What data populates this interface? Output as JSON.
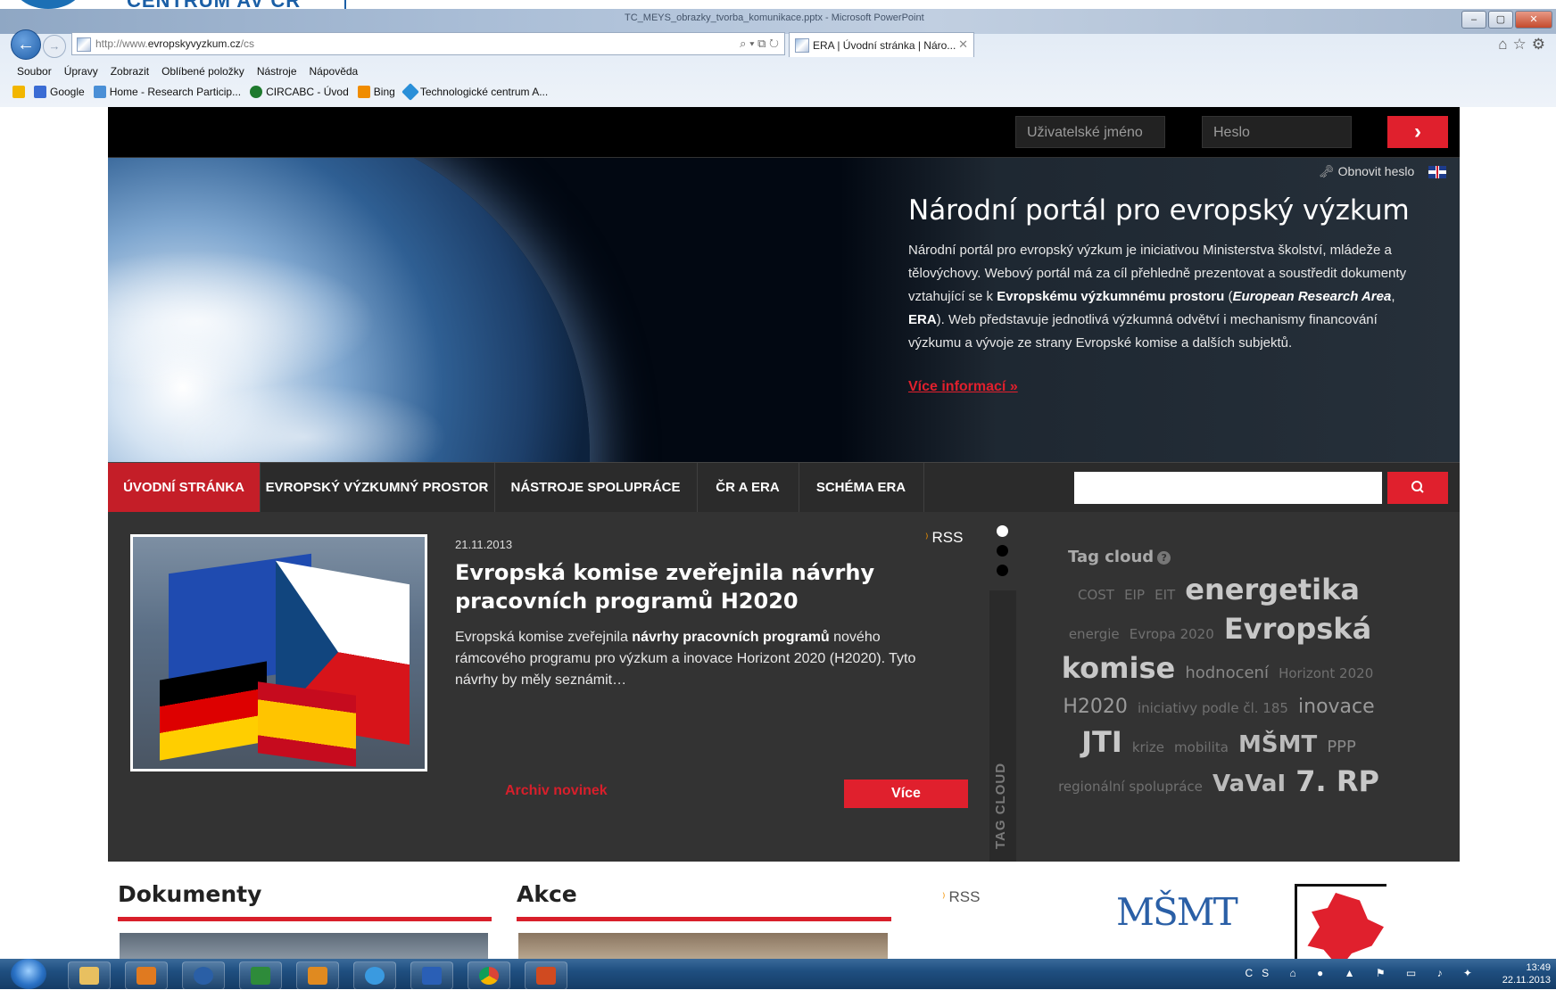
{
  "slide_header": {
    "title": "CENTRUM AV ČR"
  },
  "browser": {
    "window_title": "TC_MEYS_obrazky_tvorba_komunikace.pptx - Microsoft PowerPoint",
    "url_prefix": "http://www.",
    "url_domain": "evropskyvyzkum.cz",
    "url_suffix": "/cs",
    "tab_title": "ERA | Úvodní stránka | Náro...",
    "menu": [
      "Soubor",
      "Úpravy",
      "Zobrazit",
      "Oblíbené položky",
      "Nástroje",
      "Nápověda"
    ],
    "favorites": [
      {
        "label": "",
        "color": "#f2b600"
      },
      {
        "label": "Google",
        "color": "#3a6cd4"
      },
      {
        "label": "Home - Research Particip...",
        "color": "#4a8fd6"
      },
      {
        "label": "CIRCABC - Úvod",
        "color": "#1e7a2e"
      },
      {
        "label": "Bing",
        "color": "#f08c00"
      },
      {
        "label": "Technologické centrum A...",
        "color": "#2a8fd8"
      }
    ]
  },
  "login": {
    "user_placeholder": "Uživatelské jméno",
    "pass_placeholder": "Heslo",
    "submit_icon": "chevron-right-icon",
    "reset_label": "Obnovit heslo",
    "language_icon": "uk-flag-icon"
  },
  "hero": {
    "title": "Národní portál pro evropský výzkum",
    "text_1": "Národní portál pro evropský výzkum je iniciativou Ministerstva školství, mládeže a tělovýchovy. Webový portál má za cíl přehledně prezentovat a soustředit dokumenty vztahující se k ",
    "text_bold_1": "Evropskému výzkumnému prostoru",
    "text_2": " (",
    "text_bold_italic": "European Research Area",
    "text_3": ", ",
    "text_bold_2": "ERA",
    "text_4": "). Web představuje jednotlivá výzkumná odvětví i mechanismy financování výzkumu a vývoje ze strany Evropské komise a dalších subjektů.",
    "more_link": "Více informací »"
  },
  "nav": {
    "items": [
      "ÚVODNÍ STRÁNKA",
      "EVROPSKÝ VÝZKUMNÝ PROSTOR",
      "NÁSTROJE SPOLUPRÁCE",
      "ČR A ERA",
      "SCHÉMA ERA"
    ],
    "search_placeholder": "",
    "search_icon": "search-icon"
  },
  "news": {
    "date": "21.11.2013",
    "rss": "RSS",
    "title": "Evropská komise zveřejnila návrhy pracovních programů H2020",
    "text_1": "Evropská komise zveřejnila ",
    "text_bold": "návrhy pracovních programů",
    "text_2": " nového rámcového programu pro výzkum a inovace Horizont 2020 (H2020). Tyto návrhy by měly seznámit…",
    "archive_link": "Archiv novinek",
    "more_button": "Více",
    "tag_cloud_tab": "TAG CLOUD"
  },
  "tag_cloud": {
    "title": "Tag cloud",
    "help": "?",
    "tags": [
      {
        "text": "COST",
        "size": "s"
      },
      {
        "text": "EIP",
        "size": "s"
      },
      {
        "text": "EIT",
        "size": "s"
      },
      {
        "text": "energetika",
        "size": "xxl"
      },
      {
        "text": "energie",
        "size": "s"
      },
      {
        "text": "Evropa 2020",
        "size": "s"
      },
      {
        "text": "Evropská komise",
        "size": "xxl"
      },
      {
        "text": "hodnocení",
        "size": "m"
      },
      {
        "text": "Horizont 2020",
        "size": "s"
      },
      {
        "text": "H2020",
        "size": "l"
      },
      {
        "text": "iniciativy podle čl. 185",
        "size": "s"
      },
      {
        "text": "inovace",
        "size": "l"
      },
      {
        "text": "JTI",
        "size": "xxl"
      },
      {
        "text": "krize",
        "size": "s"
      },
      {
        "text": "mobilita",
        "size": "s"
      },
      {
        "text": "MŠMT",
        "size": "xl"
      },
      {
        "text": "PPP",
        "size": "m"
      },
      {
        "text": "regionální spolupráce",
        "size": "s"
      },
      {
        "text": "VaVaI",
        "size": "xl"
      },
      {
        "text": "7. RP",
        "size": "xxl"
      }
    ]
  },
  "bottom": {
    "documents_title": "Dokumenty",
    "events_title": "Akce",
    "events_rss": "RSS",
    "msmt_logo": "MŠMT"
  },
  "taskbar": {
    "tray_lang": "CS",
    "time": "13:49",
    "date": "22.11.2013"
  }
}
